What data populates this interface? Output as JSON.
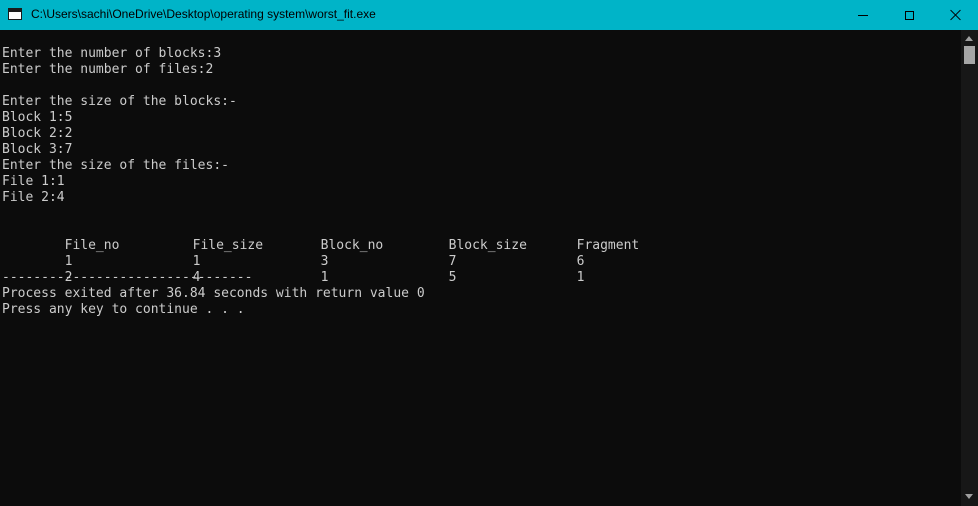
{
  "window": {
    "title": "C:\\Users\\sachi\\OneDrive\\Desktop\\operating system\\worst_fit.exe",
    "icon": "console-app-icon",
    "colors": {
      "titlebar": "#00b4c8",
      "background": "#0c0c0c",
      "text": "#cccccc"
    }
  },
  "console": {
    "intro": [
      "Enter the number of blocks:3",
      "Enter the number of files:2",
      "",
      "Enter the size of the blocks:-",
      "Block 1:5",
      "Block 2:2",
      "Block 3:7",
      "Enter the size of the files:-",
      "File 1:1",
      "File 2:4",
      ""
    ],
    "table": {
      "headers": [
        "File_no",
        "File_size",
        "Block_no",
        "Block_size",
        "Fragment"
      ],
      "rows": [
        [
          "1",
          "1",
          "3",
          "7",
          "6"
        ],
        [
          "2",
          "4",
          "1",
          "5",
          "1"
        ]
      ]
    },
    "footer": [
      "--------------------------------",
      "Process exited after 36.84 seconds with return value 0",
      "Press any key to continue . . ."
    ]
  }
}
